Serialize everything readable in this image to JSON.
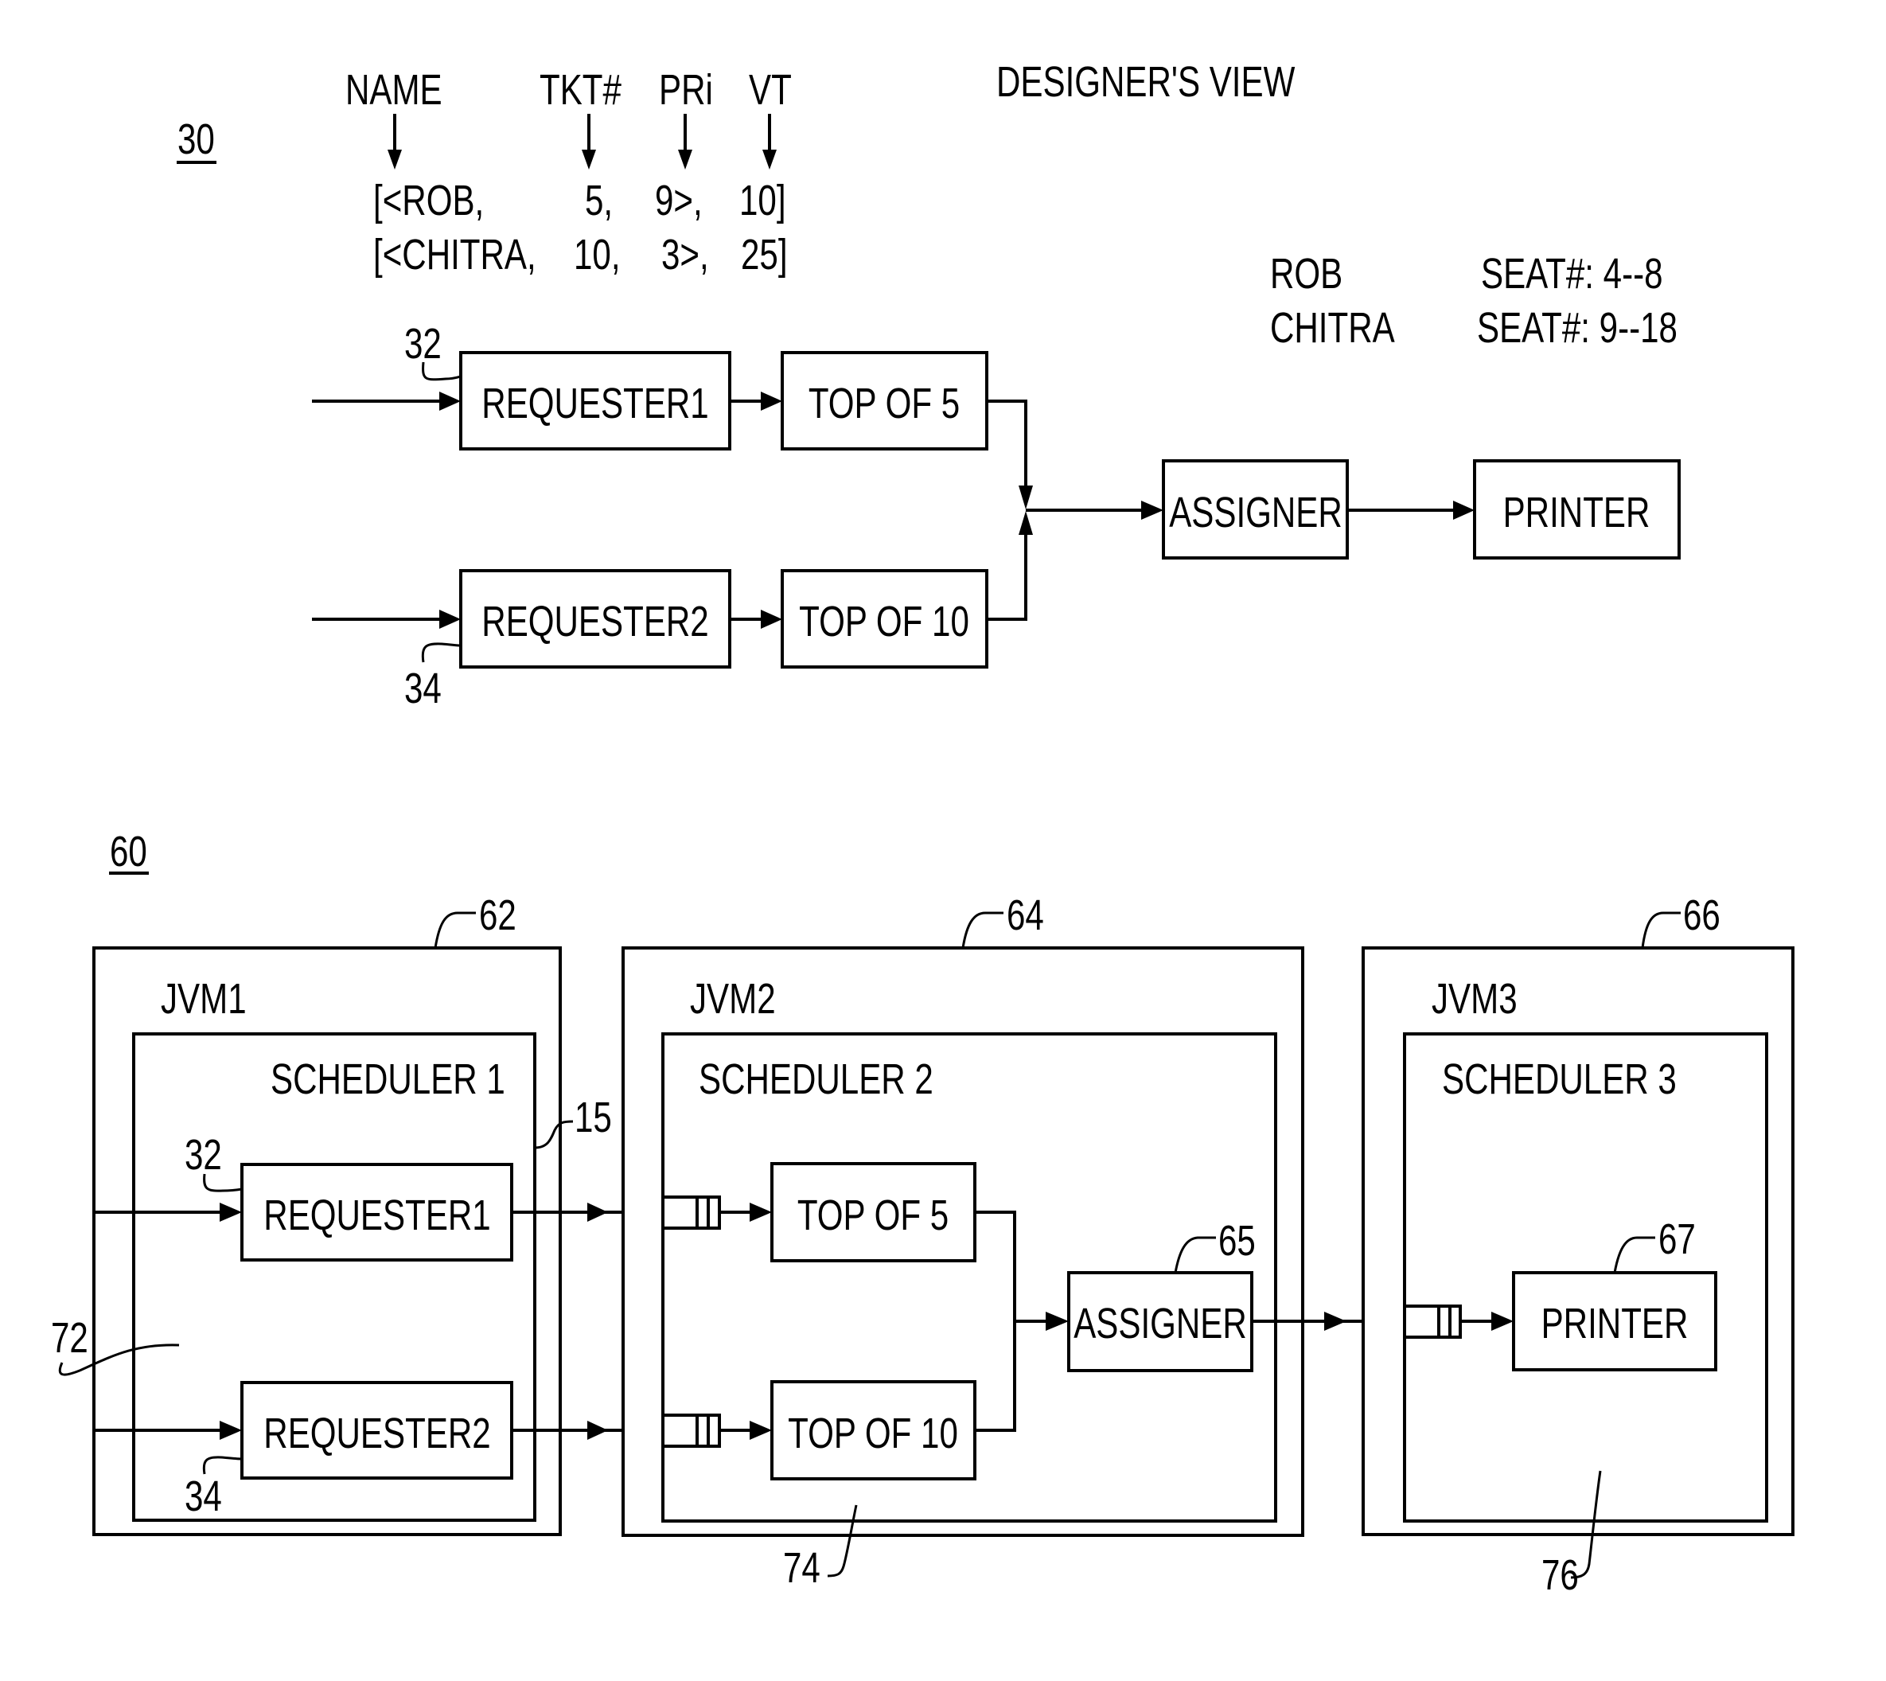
{
  "figure_30": {
    "ref_label": "30",
    "title": "DESIGNER'S VIEW",
    "tuple_headers": [
      "NAME",
      "TKT#",
      "PRi",
      "VT"
    ],
    "tuples": [
      [
        "[<ROB,",
        "5,",
        "9>,",
        "10]"
      ],
      [
        "[<CHITRA,",
        "10,",
        "3>,",
        "25]"
      ]
    ],
    "seat_assignments": [
      {
        "name": "ROB",
        "seat": "SEAT#:  4--8"
      },
      {
        "name": "CHITRA",
        "seat": "SEAT#:  9--18"
      }
    ],
    "nodes": {
      "requester1": "REQUESTER1",
      "requester2": "REQUESTER2",
      "top5": "TOP OF 5",
      "top10": "TOP OF 10",
      "assigner": "ASSIGNER",
      "printer": "PRINTER"
    },
    "refs": {
      "requester1": "32",
      "requester2": "34"
    }
  },
  "figure_60": {
    "ref_label": "60",
    "jvms": [
      {
        "label": "JVM1",
        "ref": "62",
        "scheduler": "SCHEDULER 1"
      },
      {
        "label": "JVM2",
        "ref": "64",
        "scheduler": "SCHEDULER 2"
      },
      {
        "label": "JVM3",
        "ref": "66",
        "scheduler": "SCHEDULER 3"
      }
    ],
    "nodes": {
      "requester1": "REQUESTER1",
      "requester2": "REQUESTER2",
      "top5": "TOP OF 5",
      "top10": "TOP OF 10",
      "assigner": "ASSIGNER",
      "printer": "PRINTER"
    },
    "refs": {
      "requester1": "32",
      "requester2": "34",
      "scheduler1": "15",
      "jvm1_region": "72",
      "scheduler2_region": "74",
      "scheduler3_region": "76",
      "assigner": "65",
      "printer": "67"
    }
  }
}
